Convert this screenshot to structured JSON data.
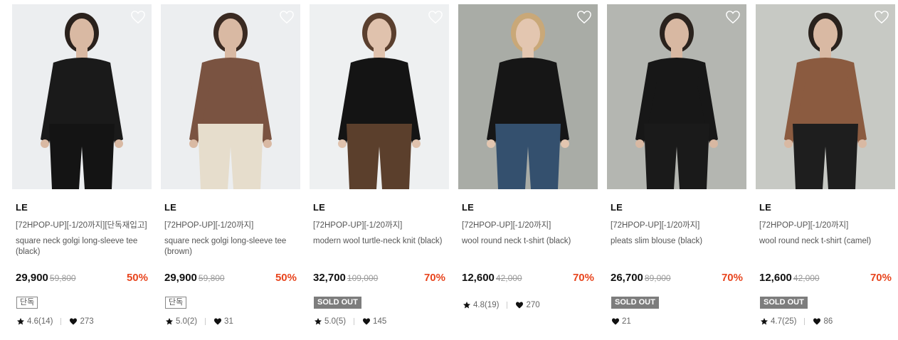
{
  "products": [
    {
      "brand": "LE",
      "promo": "[72HPOP-UP][-1/20까지][단독재입고]",
      "name": "square neck golgi long-sleeve tee (black)",
      "price": "29,900",
      "original_price": "59,800",
      "discount": "50%",
      "badge": "단독",
      "badge_type": "outline",
      "rating": "4.6(14)",
      "likes": "273",
      "photo": {
        "bg": "#eceef0",
        "top": "#1a1a1a",
        "bottom": "#141414",
        "skin": "#d9b9a3",
        "hair": "#2a211c"
      }
    },
    {
      "brand": "LE",
      "promo": "[72HPOP-UP][-1/20까지]",
      "name": "square neck golgi long-sleeve tee (brown)",
      "price": "29,900",
      "original_price": "59,800",
      "discount": "50%",
      "badge": "단독",
      "badge_type": "outline",
      "rating": "5.0(2)",
      "likes": "31",
      "photo": {
        "bg": "#eceef0",
        "top": "#7a5341",
        "bottom": "#e6ddcc",
        "skin": "#d9b9a3",
        "hair": "#3a2a22"
      }
    },
    {
      "brand": "LE",
      "promo": "[72HPOP-UP][-1/20까지]",
      "name": "modern wool turtle-neck knit (black)",
      "price": "32,700",
      "original_price": "109,000",
      "discount": "70%",
      "badge": "SOLD OUT",
      "badge_type": "soldout",
      "rating": "5.0(5)",
      "likes": "145",
      "photo": {
        "bg": "#eef0f1",
        "top": "#141414",
        "bottom": "#5b3f2c",
        "skin": "#e0c2ad",
        "hair": "#5a3f2e"
      }
    },
    {
      "brand": "LE",
      "promo": "[72HPOP-UP][-1/20까지]",
      "name": "wool round neck t-shirt (black)",
      "price": "12,600",
      "original_price": "42,000",
      "discount": "70%",
      "badge": "",
      "badge_type": "none",
      "rating": "4.8(19)",
      "likes": "270",
      "photo": {
        "bg": "#a9aca6",
        "top": "#161616",
        "bottom": "#34506e",
        "skin": "#e3c6b0",
        "hair": "#c9a878"
      }
    },
    {
      "brand": "LE",
      "promo": "[72HPOP-UP][-1/20까지]",
      "name": "pleats slim blouse (black)",
      "price": "26,700",
      "original_price": "89,000",
      "discount": "70%",
      "badge": "SOLD OUT",
      "badge_type": "soldout",
      "rating": "",
      "likes": "21",
      "photo": {
        "bg": "#b4b6b1",
        "top": "#171717",
        "bottom": "#1a1a1a",
        "skin": "#d8b8a2",
        "hair": "#2a221d"
      }
    },
    {
      "brand": "LE",
      "promo": "[72HPOP-UP][-1/20까지]",
      "name": "wool round neck t-shirt (camel)",
      "price": "12,600",
      "original_price": "42,000",
      "discount": "70%",
      "badge": "SOLD OUT",
      "badge_type": "soldout",
      "rating": "4.7(25)",
      "likes": "86",
      "photo": {
        "bg": "#c7c9c4",
        "top": "#8b5b40",
        "bottom": "#1e1e1e",
        "skin": "#d9b9a3",
        "hair": "#2a221d"
      }
    }
  ],
  "colors": {
    "discount": "#e8451e",
    "soldout_bg": "#7d7d7d",
    "text": "#222222"
  }
}
